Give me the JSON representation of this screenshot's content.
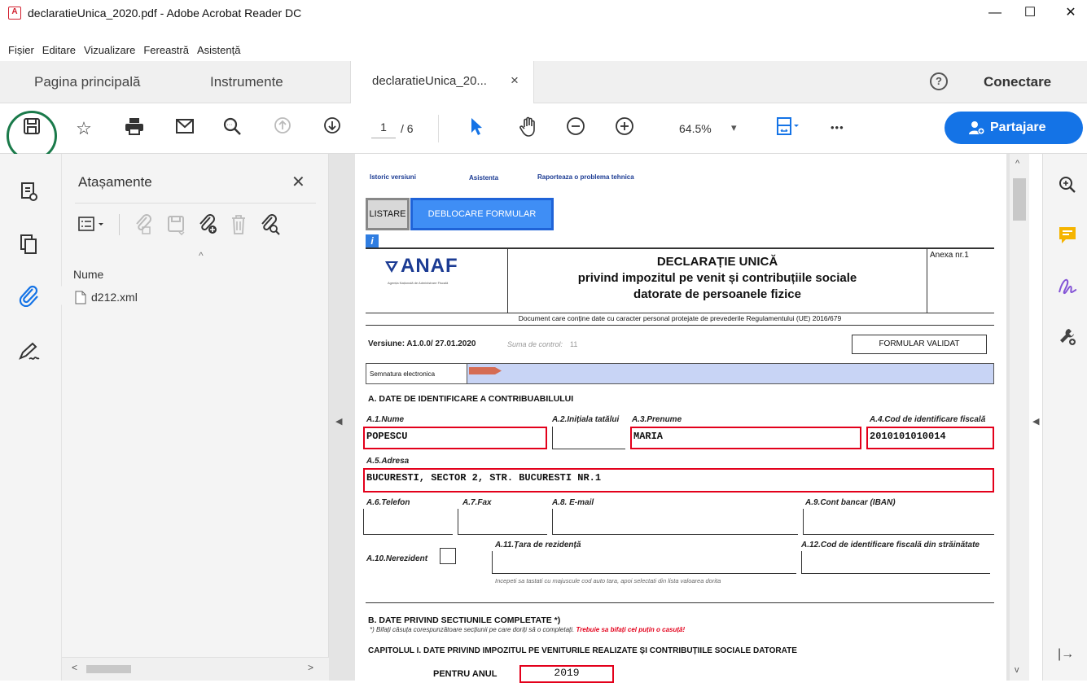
{
  "window": {
    "title": "declaratieUnica_2020.pdf - Adobe Acrobat Reader DC",
    "min": "—",
    "max": "☐",
    "close": "✕"
  },
  "menu": [
    "Fișier",
    "Editare",
    "Vizualizare",
    "Fereastră",
    "Asistență"
  ],
  "tabs": {
    "home": "Pagina principală",
    "tools": "Instrumente",
    "doc": "declaratieUnica_20...",
    "doc_close": "×",
    "help": "?",
    "connect": "Conectare"
  },
  "toolbar": {
    "page_current": "1",
    "page_total": "/ 6",
    "zoom": "64.5%",
    "zoom_arrow": "▾",
    "more": "•••",
    "share": "Partajare"
  },
  "attachments": {
    "title": "Atașamente",
    "close": "✕",
    "col": "Nume",
    "sort": "^",
    "files": [
      "d212.xml"
    ]
  },
  "form": {
    "links": [
      "Istoric versiuni",
      "Asistenta",
      "Raporteaza o problema tehnica"
    ],
    "btn_list": "LISTARE",
    "btn_unlock": "DEBLOCARE FORMULAR",
    "info": "i",
    "logo": "ANAF",
    "logo_sub": "Agenția Națională de Administrare Fiscală",
    "title1": "DECLARAȚIE UNICĂ",
    "title2": "privind impozitul pe venit și contribuțiile sociale",
    "title3": "datorate de persoanele fizice",
    "annex": "Anexa nr.1",
    "gdpr": "Document care conține date cu caracter personal protejate de prevederile Regulamentului (UE) 2016/679",
    "version": "Versiune: A1.0.0/ 27.01.2020",
    "control": "Suma de control:",
    "control_val": "11",
    "valid": "FORMULAR VALIDAT",
    "sig": "Semnatura electronica",
    "secA": "A. DATE DE IDENTIFICARE A CONTRIBUABILULUI",
    "a1": "A.1.Nume",
    "a1v": "POPESCU",
    "a2": "A.2.Inițiala tatălui",
    "a3": "A.3.Prenume",
    "a3v": "MARIA",
    "a4": "A.4.Cod de identificare fiscală",
    "a4v": "2010101010014",
    "a5": "A.5.Adresa",
    "a5v": "BUCURESTI, SECTOR 2, STR. BUCURESTI NR.1",
    "a6": "A.6.Telefon",
    "a7": "A.7.Fax",
    "a8": "A.8. E-mail",
    "a9": "A.9.Cont bancar (IBAN)",
    "a10": "A.10.Nerezident",
    "a11": "A.11.Țara de rezidență",
    "a12": "A.12.Cod de identificare fiscală din străinătate",
    "hint": "Incepeti sa tastati cu majuscule cod auto tara, apoi selectati din lista valoarea dorita",
    "secB": "B. DATE PRIVIND SECTIUNILE COMPLETATE *)",
    "noteB1": "*) Bifați căsuța corespunzătoare secțiunii pe care doriți să o completați.",
    "noteB2": "Trebuie sa bifați cel puțin o casuță!",
    "cap1": "CAPITOLUL I. DATE PRIVIND IMPOZITUL PE VENITURILE REALIZATE ȘI CONTRIBUȚIILE SOCIALE DATORATE",
    "year_lbl": "PENTRU ANUL",
    "year": "2019"
  }
}
